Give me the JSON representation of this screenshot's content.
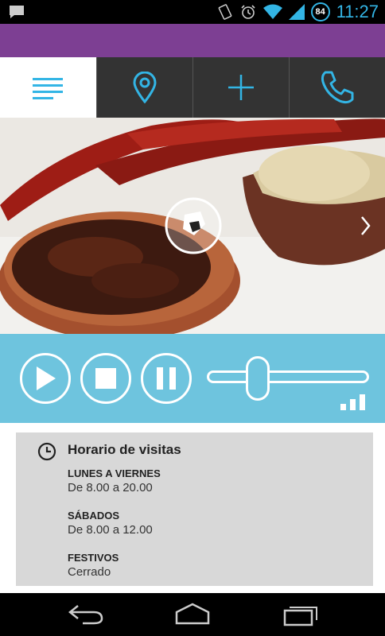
{
  "status_bar": {
    "time": "11:27",
    "battery": "84"
  },
  "tabs": [
    {
      "name": "menu",
      "icon": "menu-icon"
    },
    {
      "name": "location",
      "icon": "location-pin-icon"
    },
    {
      "name": "add",
      "icon": "plus-icon"
    },
    {
      "name": "call",
      "icon": "phone-icon"
    }
  ],
  "player": {
    "volume": 0.28
  },
  "hours": {
    "title": "Horario de visitas",
    "entries": [
      {
        "label": "LUNES A VIERNES",
        "value": "De 8.00 a 20.00"
      },
      {
        "label": "SÁBADOS",
        "value": "De 8.00 a 12.00"
      },
      {
        "label": "FESTIVOS",
        "value": "Cerrado"
      }
    ]
  },
  "colors": {
    "header": "#7d3f93",
    "accent": "#33b5e5",
    "player": "#6ec4de",
    "tab_bar": "#333333"
  }
}
